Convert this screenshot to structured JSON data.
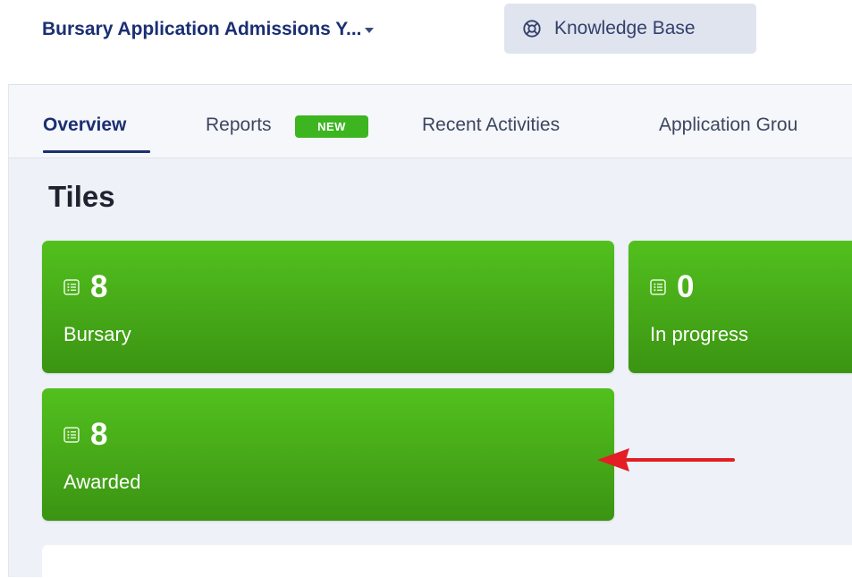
{
  "header": {
    "app_title": "Bursary Application Admissions Y...",
    "knowledge_base_label": "Knowledge Base"
  },
  "tabs": [
    {
      "label": "Overview",
      "active": true
    },
    {
      "label": "Reports",
      "badge": "NEW"
    },
    {
      "label": "Recent Activities"
    },
    {
      "label": "Application Grou"
    }
  ],
  "section_title": "Tiles",
  "tiles": [
    {
      "count": "8",
      "label": "Bursary",
      "icon": "list-icon"
    },
    {
      "count": "0",
      "label": "In progress",
      "icon": "list-icon"
    },
    {
      "count": "8",
      "label": "Awarded",
      "icon": "list-icon"
    }
  ],
  "colors": {
    "brand_navy": "#1b2f72",
    "tile_green": "#46a818",
    "badge_green": "#3cb521",
    "annotation_red": "#e31e24"
  }
}
